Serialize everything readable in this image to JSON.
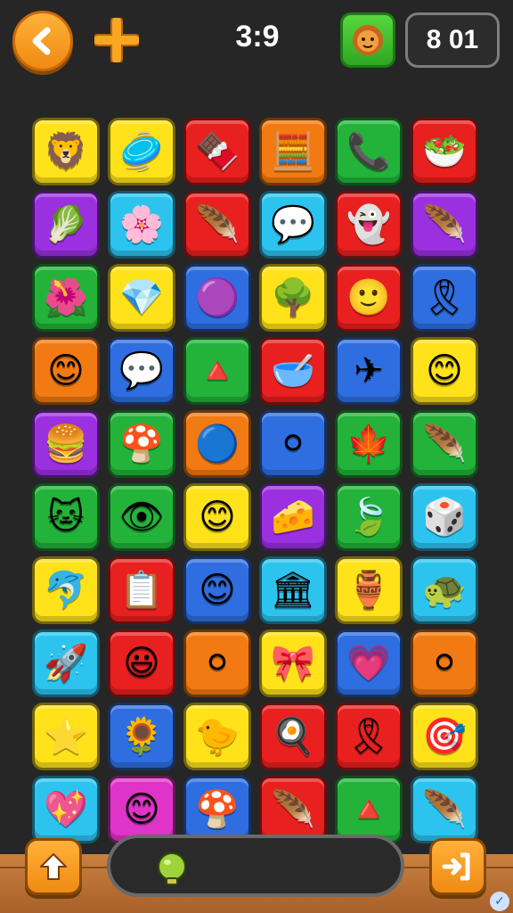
{
  "header": {
    "timer": "3:9",
    "score": "8 01",
    "back_icon": "chevron-left-icon",
    "plus_icon": "plus-icon",
    "avatar_icon": "lion-face-icon"
  },
  "colors": {
    "yellow": "#ffe21a",
    "red": "#e8201f",
    "green": "#23b33a",
    "purple": "#9b30e0",
    "cyan": "#2cc4ef",
    "orange": "#f27a12",
    "blue": "#2f6ee0",
    "magenta": "#e033c8",
    "orange_accent": "#f5a020"
  },
  "board": {
    "rows": [
      [
        {
          "c": "yellow",
          "g": "🦁",
          "icon": "lion-icon"
        },
        {
          "c": "yellow",
          "g": "🥏",
          "icon": "disc-icon"
        },
        {
          "c": "red",
          "g": "🍫",
          "icon": "cake-icon"
        },
        {
          "c": "orange",
          "g": "🧮",
          "icon": "calculator-icon"
        },
        {
          "c": "green",
          "g": "📞",
          "icon": "phone-icon"
        },
        {
          "c": "red",
          "g": "🥗",
          "icon": "bowl-icon"
        }
      ],
      [
        {
          "c": "purple",
          "g": "🥬",
          "icon": "leaf-icon"
        },
        {
          "c": "cyan",
          "g": "🌸",
          "icon": "flower-icon"
        },
        {
          "c": "red",
          "g": "🪶",
          "icon": "feather-icon"
        },
        {
          "c": "cyan",
          "g": "💬",
          "icon": "speech-bubble-icon"
        },
        {
          "c": "red",
          "g": "👻",
          "icon": "ghost-icon"
        },
        {
          "c": "purple",
          "g": "🪶",
          "icon": "feather-icon"
        }
      ],
      [
        {
          "c": "green",
          "g": "🌺",
          "icon": "flower-icon"
        },
        {
          "c": "yellow",
          "g": "💎",
          "icon": "gem-icon"
        },
        {
          "c": "blue",
          "g": "🟣",
          "icon": "blob-icon"
        },
        {
          "c": "yellow",
          "g": "🌳",
          "icon": "tree-icon"
        },
        {
          "c": "red",
          "g": "🙂",
          "icon": "face-icon"
        },
        {
          "c": "blue",
          "g": "🎗",
          "icon": "badge-icon"
        }
      ],
      [
        {
          "c": "orange",
          "g": "😊",
          "icon": "smiley-icon"
        },
        {
          "c": "blue",
          "g": "💬",
          "icon": "speech-bubble-icon"
        },
        {
          "c": "green",
          "g": "🔺",
          "icon": "triangle-icon"
        },
        {
          "c": "red",
          "g": "🥣",
          "icon": "bowl-icon"
        },
        {
          "c": "blue",
          "g": "✈",
          "icon": "plane-icon"
        },
        {
          "c": "yellow",
          "g": "😊",
          "icon": "face-icon"
        }
      ],
      [
        {
          "c": "purple",
          "g": "🍔",
          "icon": "burger-icon"
        },
        {
          "c": "green",
          "g": "🍄",
          "icon": "mushroom-icon"
        },
        {
          "c": "orange",
          "g": "🔵",
          "icon": "blob-icon"
        },
        {
          "c": "blue",
          "g": "⚪",
          "icon": "smiley-icon"
        },
        {
          "c": "green",
          "g": "🍁",
          "icon": "leaf-icon"
        },
        {
          "c": "green",
          "g": "🪶",
          "icon": "feather-icon"
        }
      ],
      [
        {
          "c": "green",
          "g": "🐱",
          "icon": "cat-icon"
        },
        {
          "c": "green",
          "g": "👁",
          "icon": "eye-bubble-icon"
        },
        {
          "c": "yellow",
          "g": "😊",
          "icon": "smiley-icon"
        },
        {
          "c": "purple",
          "g": "🧀",
          "icon": "cheese-icon"
        },
        {
          "c": "green",
          "g": "🍃",
          "icon": "leaf-icon"
        },
        {
          "c": "cyan",
          "g": "🎲",
          "icon": "dice-icon"
        }
      ],
      [
        {
          "c": "yellow",
          "g": "🐬",
          "icon": "creature-icon"
        },
        {
          "c": "red",
          "g": "📋",
          "icon": "notepad-icon"
        },
        {
          "c": "blue",
          "g": "😊",
          "icon": "smiley-icon"
        },
        {
          "c": "cyan",
          "g": "🏛",
          "icon": "building-icon"
        },
        {
          "c": "yellow",
          "g": "🏺",
          "icon": "arch-icon"
        },
        {
          "c": "cyan",
          "g": "🐢",
          "icon": "turtle-icon"
        }
      ],
      [
        {
          "c": "cyan",
          "g": "🚀",
          "icon": "rocket-icon"
        },
        {
          "c": "red",
          "g": "😃",
          "icon": "smiley-icon"
        },
        {
          "c": "orange",
          "g": "⚪",
          "icon": "smiley-icon"
        },
        {
          "c": "yellow",
          "g": "🎀",
          "icon": "ribbon-icon"
        },
        {
          "c": "blue",
          "g": "💗",
          "icon": "heart-bubble-icon"
        },
        {
          "c": "orange",
          "g": "⚪",
          "icon": "smiley-icon"
        }
      ],
      [
        {
          "c": "yellow",
          "g": "⭐",
          "icon": "star-icon"
        },
        {
          "c": "blue",
          "g": "🌻",
          "icon": "sunflower-icon"
        },
        {
          "c": "yellow",
          "g": "🐤",
          "icon": "bird-icon"
        },
        {
          "c": "red",
          "g": "🍳",
          "icon": "egg-icon"
        },
        {
          "c": "red",
          "g": "🎗",
          "icon": "ribbon-icon"
        },
        {
          "c": "yellow",
          "g": "🎯",
          "icon": "target-icon"
        }
      ],
      [
        {
          "c": "cyan",
          "g": "💖",
          "icon": "heart-icon"
        },
        {
          "c": "magenta",
          "g": "😊",
          "icon": "smiley-icon"
        },
        {
          "c": "blue",
          "g": "🍄",
          "icon": "mushroom-icon"
        },
        {
          "c": "red",
          "g": "🪶",
          "icon": "feather-icon"
        },
        {
          "c": "green",
          "g": "🔺",
          "icon": "triangle-icon"
        },
        {
          "c": "cyan",
          "g": "🪶",
          "icon": "feather-icon"
        }
      ]
    ]
  },
  "footer": {
    "up_icon": "arrow-up-icon",
    "exit_icon": "exit-icon",
    "tray_item_icon": "bulb-icon",
    "corner_icon": "badge-icon"
  }
}
